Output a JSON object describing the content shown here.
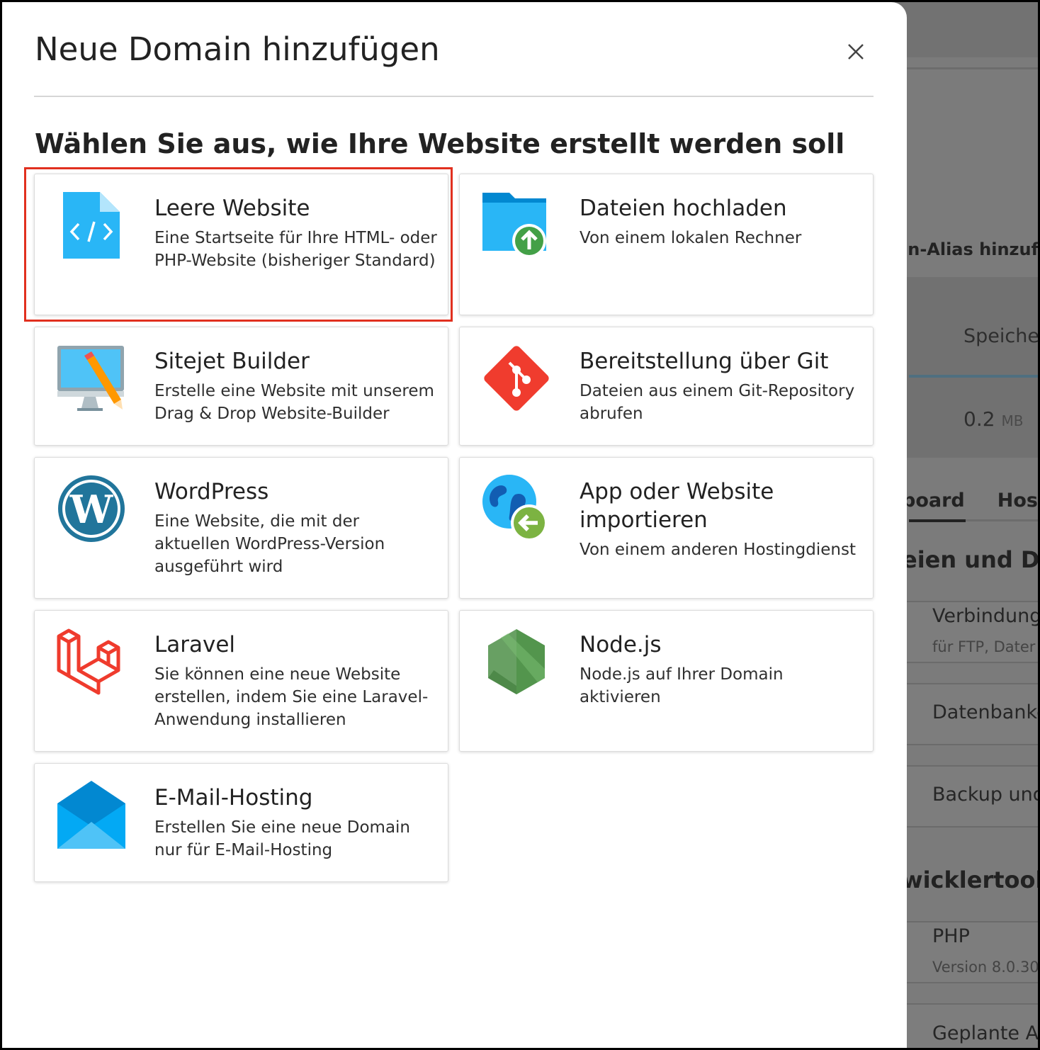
{
  "modal": {
    "title": "Neue Domain hinzufügen",
    "subtitle": "Wählen Sie aus, wie Ihre Website erstellt werden soll",
    "close_icon": "close-icon",
    "cards": [
      {
        "title": "Leere Website",
        "desc": "Eine Startseite für Ihre HTML- oder PHP-Website (bisheriger Standard)",
        "icon": "code-file-icon"
      },
      {
        "title": "Dateien hochladen",
        "desc": "Von einem lokalen Rechner",
        "icon": "folder-upload-icon"
      },
      {
        "title": "Sitejet Builder",
        "desc": "Erstelle eine Website mit unserem Drag & Drop Website-Builder",
        "icon": "monitor-pencil-icon"
      },
      {
        "title": "Bereitstellung über Git",
        "desc": "Dateien aus einem Git-Repository abrufen",
        "icon": "git-icon"
      },
      {
        "title": "WordPress",
        "desc": "Eine Website, die mit der aktuellen WordPress-Version ausgeführt wird",
        "icon": "wordpress-icon"
      },
      {
        "title": "App oder Website importieren",
        "desc": "Von einem anderen Hostingdienst",
        "icon": "globe-import-icon"
      },
      {
        "title": "Laravel",
        "desc": "Sie können eine neue Website erstellen, indem Sie eine Laravel-Anwendung installieren",
        "icon": "laravel-icon"
      },
      {
        "title": "Node.js",
        "desc": "Node.js auf Ihrer Domain aktivieren",
        "icon": "nodejs-icon"
      },
      {
        "title": "E-Mail-Hosting",
        "desc": "Erstellen Sie eine neue Domain nur für E-Mail-Hosting",
        "icon": "envelope-icon"
      }
    ]
  },
  "background": {
    "alias": "in-Alias hinzufüg",
    "storage_label": "Speicher",
    "storage_value": "0.2",
    "storage_unit": "MB",
    "tabs": [
      "board",
      "Hos"
    ],
    "section1": "eien und Dat",
    "items": [
      {
        "label": "Verbindung",
        "sub": "für FTP, Dater"
      },
      {
        "label": "Datenbanke",
        "sub": ""
      },
      {
        "label": "Backup und",
        "sub": ""
      }
    ],
    "section2": "wicklertools",
    "items2": [
      {
        "label": "PHP",
        "sub": "Version 8.0.30"
      },
      {
        "label": "Geplante Au",
        "sub": ""
      }
    ]
  },
  "colors": {
    "highlight": "#e1301f",
    "accent_blue": "#29b6f6"
  }
}
